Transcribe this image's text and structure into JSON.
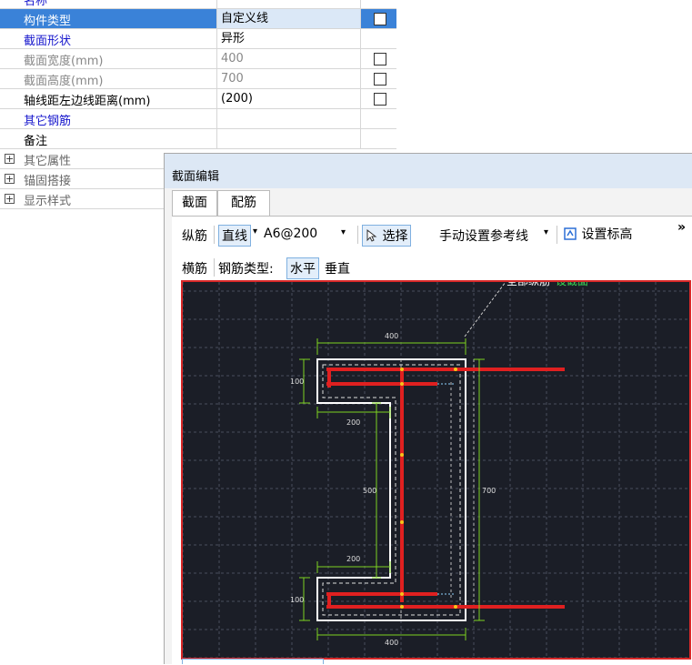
{
  "properties": {
    "rows": [
      {
        "name": "名称",
        "value": "",
        "style": "blue"
      },
      {
        "name": "构件类型",
        "value": "自定义线"
      },
      {
        "name": "截面形状",
        "value": "异形"
      },
      {
        "name": "截面宽度(mm)",
        "value": "400"
      },
      {
        "name": "截面高度(mm)",
        "value": "700"
      },
      {
        "name": "轴线距左边线距离(mm)",
        "value": "(200)"
      },
      {
        "name": "其它钢筋",
        "value": ""
      },
      {
        "name": "备注",
        "value": ""
      },
      {
        "name": "其它属性"
      },
      {
        "name": "锚固搭接"
      },
      {
        "name": "显示样式"
      }
    ],
    "expander_symbol": "+"
  },
  "dialog": {
    "title": "截面编辑",
    "tabs": [
      "截面",
      "配筋"
    ],
    "toolbar1": {
      "longitudinal": "纵筋",
      "straight": "直线",
      "rebar_spec": "A6@200",
      "select": "选择",
      "manual_ref": "手动设置参考线",
      "set_elevation": "设置标高",
      "more": "»"
    },
    "toolbar2": {
      "transverse": "横筋",
      "rebar_type_label": "钢筋类型:",
      "horizontal": "水平",
      "vertical": "垂直"
    },
    "canvas": {
      "top_label_white": "全部纵筋",
      "top_label_green": "设截面",
      "dims": {
        "top_width": "400",
        "bottom_width": "400",
        "upper_flange": "100",
        "lower_flange": "100",
        "upper_offset": "200",
        "lower_offset": "200",
        "web_height": "500",
        "total_height": "700"
      },
      "colors": {
        "background": "#1b1e27",
        "rebar": "#e02020",
        "outline": "#ffffff",
        "dimension": "#7ed321"
      }
    }
  }
}
